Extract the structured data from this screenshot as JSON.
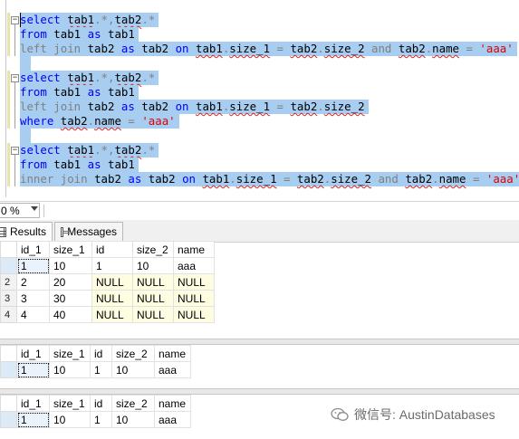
{
  "editor": {
    "blocks": [
      {
        "lines": [
          [
            {
              "t": "select",
              "c": "kw"
            },
            {
              "t": " "
            },
            {
              "t": "tab1",
              "c": "squig"
            },
            {
              "t": ".*,",
              "c": "gray"
            },
            {
              "t": "tab2",
              "c": "squig"
            },
            {
              "t": ".*",
              "c": "gray"
            }
          ],
          [
            {
              "t": "from",
              "c": "kw"
            },
            {
              "t": " tab1 "
            },
            {
              "t": "as",
              "c": "kw"
            },
            {
              "t": " tab1"
            }
          ],
          [
            {
              "t": "left join",
              "c": "gray"
            },
            {
              "t": " tab2 "
            },
            {
              "t": "as",
              "c": "kw"
            },
            {
              "t": " tab2 "
            },
            {
              "t": "on",
              "c": "kw"
            },
            {
              "t": " "
            },
            {
              "t": "tab1",
              "c": "squig"
            },
            {
              "t": ".",
              "c": "gray"
            },
            {
              "t": "size_1",
              "c": "squig"
            },
            {
              "t": " = ",
              "c": "gray"
            },
            {
              "t": "tab2",
              "c": "squig"
            },
            {
              "t": ".",
              "c": "gray"
            },
            {
              "t": "size_2",
              "c": "squig"
            },
            {
              "t": " "
            },
            {
              "t": "and",
              "c": "gray"
            },
            {
              "t": " "
            },
            {
              "t": "tab2",
              "c": "squig"
            },
            {
              "t": ".",
              "c": "gray"
            },
            {
              "t": "name",
              "c": "squig"
            },
            {
              "t": " = ",
              "c": "gray"
            },
            {
              "t": "'aaa'",
              "c": "str"
            }
          ]
        ]
      },
      {
        "lines": [
          [
            {
              "t": "select",
              "c": "kw"
            },
            {
              "t": " "
            },
            {
              "t": "tab1",
              "c": "squig"
            },
            {
              "t": ".*,",
              "c": "gray"
            },
            {
              "t": "tab2",
              "c": "squig"
            },
            {
              "t": ".*",
              "c": "gray"
            }
          ],
          [
            {
              "t": "from",
              "c": "kw"
            },
            {
              "t": " tab1 "
            },
            {
              "t": "as",
              "c": "kw"
            },
            {
              "t": " tab1"
            }
          ],
          [
            {
              "t": "left join",
              "c": "gray"
            },
            {
              "t": " tab2 "
            },
            {
              "t": "as",
              "c": "kw"
            },
            {
              "t": " tab2 "
            },
            {
              "t": "on",
              "c": "kw"
            },
            {
              "t": " "
            },
            {
              "t": "tab1",
              "c": "squig"
            },
            {
              "t": ".",
              "c": "gray"
            },
            {
              "t": "size_1",
              "c": "squig"
            },
            {
              "t": " = ",
              "c": "gray"
            },
            {
              "t": "tab2",
              "c": "squig"
            },
            {
              "t": ".",
              "c": "gray"
            },
            {
              "t": "size_2",
              "c": "squig"
            }
          ],
          [
            {
              "t": "where",
              "c": "kw"
            },
            {
              "t": " "
            },
            {
              "t": "tab2",
              "c": "squig"
            },
            {
              "t": ".",
              "c": "gray"
            },
            {
              "t": "name",
              "c": "squig"
            },
            {
              "t": " = ",
              "c": "gray"
            },
            {
              "t": "'aaa'",
              "c": "str"
            }
          ]
        ]
      },
      {
        "lines": [
          [
            {
              "t": "select",
              "c": "kw"
            },
            {
              "t": " "
            },
            {
              "t": "tab1",
              "c": "squig"
            },
            {
              "t": ".*,",
              "c": "gray"
            },
            {
              "t": "tab2",
              "c": "squig"
            },
            {
              "t": ".*",
              "c": "gray"
            }
          ],
          [
            {
              "t": "from",
              "c": "kw"
            },
            {
              "t": " tab1 "
            },
            {
              "t": "as",
              "c": "kw"
            },
            {
              "t": " tab1"
            }
          ],
          [
            {
              "t": "inner join",
              "c": "gray"
            },
            {
              "t": " tab2 "
            },
            {
              "t": "as",
              "c": "kw"
            },
            {
              "t": " tab2 "
            },
            {
              "t": "on",
              "c": "kw"
            },
            {
              "t": " "
            },
            {
              "t": "tab1",
              "c": "squig"
            },
            {
              "t": ".",
              "c": "gray"
            },
            {
              "t": "size_1",
              "c": "squig"
            },
            {
              "t": " = ",
              "c": "gray"
            },
            {
              "t": "tab2",
              "c": "squig"
            },
            {
              "t": ".",
              "c": "gray"
            },
            {
              "t": "size_2",
              "c": "squig"
            },
            {
              "t": " "
            },
            {
              "t": "and",
              "c": "gray"
            },
            {
              "t": " "
            },
            {
              "t": "tab2",
              "c": "squig"
            },
            {
              "t": ".",
              "c": "gray"
            },
            {
              "t": "name",
              "c": "squig"
            },
            {
              "t": " = ",
              "c": "gray"
            },
            {
              "t": "'aaa'",
              "c": "str"
            }
          ]
        ]
      }
    ],
    "colors": {
      "keyword": "#0000ff",
      "operator": "#808080",
      "string": "#e00000",
      "selection": "#a7cdf0"
    }
  },
  "zoom": {
    "value": "0 %"
  },
  "tabs": {
    "results": "Results",
    "messages": "Messages"
  },
  "results": [
    {
      "columns": [
        "id_1",
        "size_1",
        "id",
        "size_2",
        "name"
      ],
      "rows": [
        {
          "rownum": "",
          "cells": [
            "1",
            "10",
            "1",
            "10",
            "aaa"
          ]
        },
        {
          "rownum": "2",
          "cells": [
            "2",
            "20",
            "NULL",
            "NULL",
            "NULL"
          ]
        },
        {
          "rownum": "3",
          "cells": [
            "3",
            "30",
            "NULL",
            "NULL",
            "NULL"
          ]
        },
        {
          "rownum": "4",
          "cells": [
            "4",
            "40",
            "NULL",
            "NULL",
            "NULL"
          ]
        }
      ]
    },
    {
      "columns": [
        "id_1",
        "size_1",
        "id",
        "size_2",
        "name"
      ],
      "rows": [
        {
          "rownum": "",
          "cells": [
            "1",
            "10",
            "1",
            "10",
            "aaa"
          ]
        }
      ]
    },
    {
      "columns": [
        "id_1",
        "size_1",
        "id",
        "size_2",
        "name"
      ],
      "rows": [
        {
          "rownum": "",
          "cells": [
            "1",
            "10",
            "1",
            "10",
            "aaa"
          ]
        }
      ]
    }
  ],
  "watermark": {
    "text": "微信号: AustinDatabases"
  }
}
